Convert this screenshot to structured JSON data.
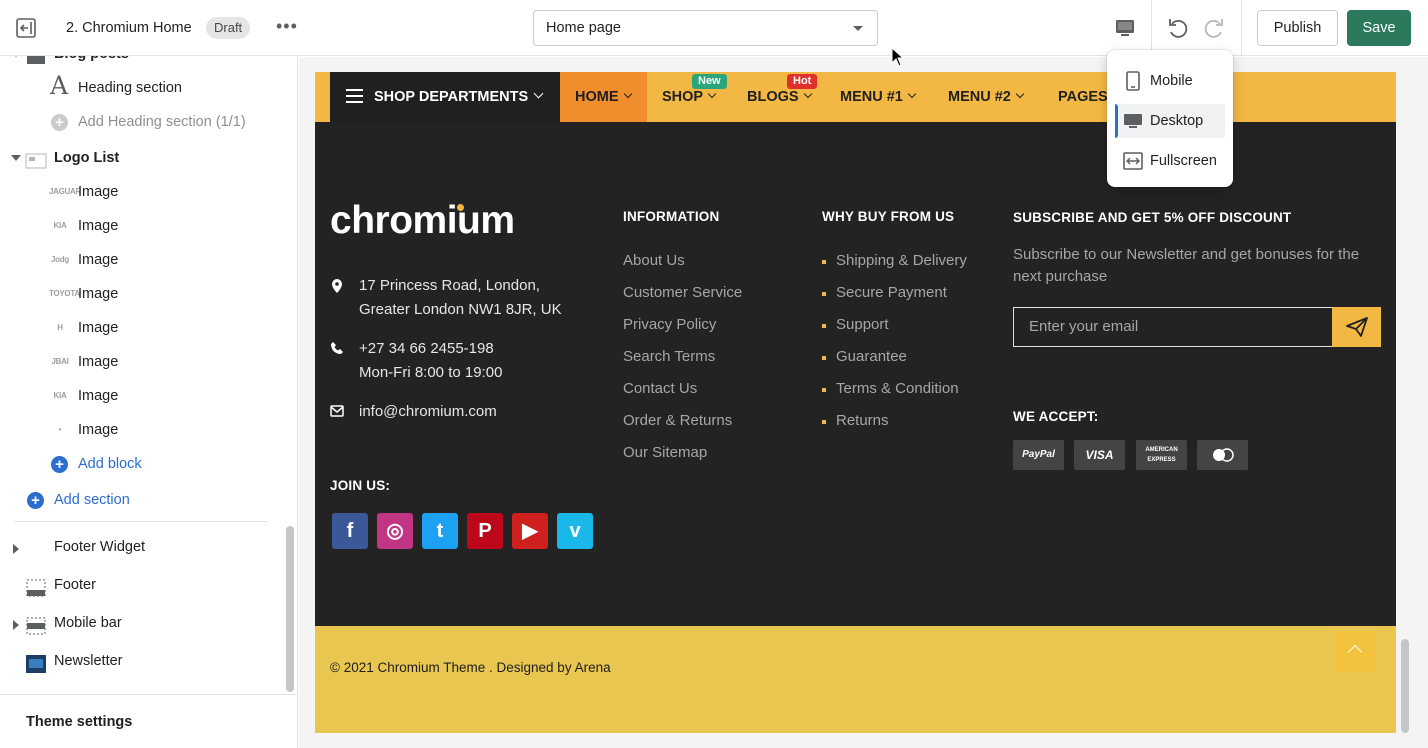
{
  "topbar": {
    "title": "2. Chromium Home",
    "status_badge": "Draft",
    "more_label": "•••",
    "page_select": "Home page",
    "publish_label": "Publish",
    "save_label": "Save",
    "icons": [
      "exit-icon",
      "more-icon",
      "desktop-icon",
      "undo-icon",
      "redo-icon"
    ]
  },
  "device_menu": {
    "items": [
      {
        "label": "Mobile",
        "icon": "mobile-icon",
        "selected": false
      },
      {
        "label": "Desktop",
        "icon": "desktop-icon",
        "selected": true
      },
      {
        "label": "Fullscreen",
        "icon": "fullscreen-icon",
        "selected": false
      }
    ]
  },
  "sidebar": {
    "partial_top": "Blog posts",
    "heading_section": "Heading section",
    "add_heading_section": "Add Heading section (1/1)",
    "logo_list": "Logo List",
    "logo_items": [
      {
        "label": "Image",
        "thumb": "JAGUAR"
      },
      {
        "label": "Image",
        "thumb": "KIA"
      },
      {
        "label": "Image",
        "thumb": "Jodg"
      },
      {
        "label": "Image",
        "thumb": "TOYOTA"
      },
      {
        "label": "Image",
        "thumb": "H"
      },
      {
        "label": "Image",
        "thumb": "JBAI"
      },
      {
        "label": "Image",
        "thumb": "KIA"
      },
      {
        "label": "Image",
        "thumb": "•"
      }
    ],
    "add_block": "Add block",
    "add_section": "Add section",
    "footer_widget": "Footer Widget",
    "footer": "Footer",
    "mobile_bar": "Mobile bar",
    "newsletter": "Newsletter",
    "theme_settings": "Theme settings"
  },
  "preview": {
    "nav": {
      "shop_departments": "SHOP DEPARTMENTS",
      "items": [
        "HOME",
        "SHOP",
        "BLOGS",
        "MENU #1",
        "MENU #2",
        "PAGES"
      ],
      "badge_new": "New",
      "badge_hot": "Hot"
    },
    "brand": "chromium",
    "contact": {
      "address_line1": "17 Princess Road, London,",
      "address_line2": "Greater London NW1 8JR, UK",
      "phone": "+27 34 66 2455-198",
      "hours": "Mon-Fri 8:00 to 19:00",
      "email": "info@chromium.com"
    },
    "join_us": "JOIN US:",
    "social": [
      "facebook-icon",
      "instagram-icon",
      "twitter-icon",
      "pinterest-icon",
      "youtube-icon",
      "vimeo-icon"
    ],
    "information": {
      "title": "INFORMATION",
      "links": [
        "About Us",
        "Customer Service",
        "Privacy Policy",
        "Search Terms",
        "Contact Us",
        "Order & Returns",
        "Our Sitemap"
      ]
    },
    "why_buy": {
      "title": "WHY BUY FROM US",
      "links": [
        "Shipping & Delivery",
        "Secure Payment",
        "Support",
        "Guarantee",
        "Terms & Condition",
        "Returns"
      ]
    },
    "subscribe": {
      "title": "SUBSCRIBE AND GET 5% OFF DISCOUNT",
      "text_line1": "Subscribe to our Newsletter and get bonuses for the",
      "text_line2": "next purchase",
      "placeholder": "Enter your email"
    },
    "we_accept": {
      "title": "WE ACCEPT:",
      "cards": [
        "PayPal",
        "VISA",
        "AMERICAN EXPRESS",
        "Mastercard"
      ]
    },
    "copyright": "© 2021 Chromium Theme . Designed by Arena"
  },
  "colors": {
    "accent_yellow": "#f3b843",
    "home_orange": "#f08d2c",
    "save_green": "#2c7a5c",
    "footer_dark": "#232323",
    "new_badge": "#2aa67a",
    "hot_badge": "#e0302b"
  }
}
